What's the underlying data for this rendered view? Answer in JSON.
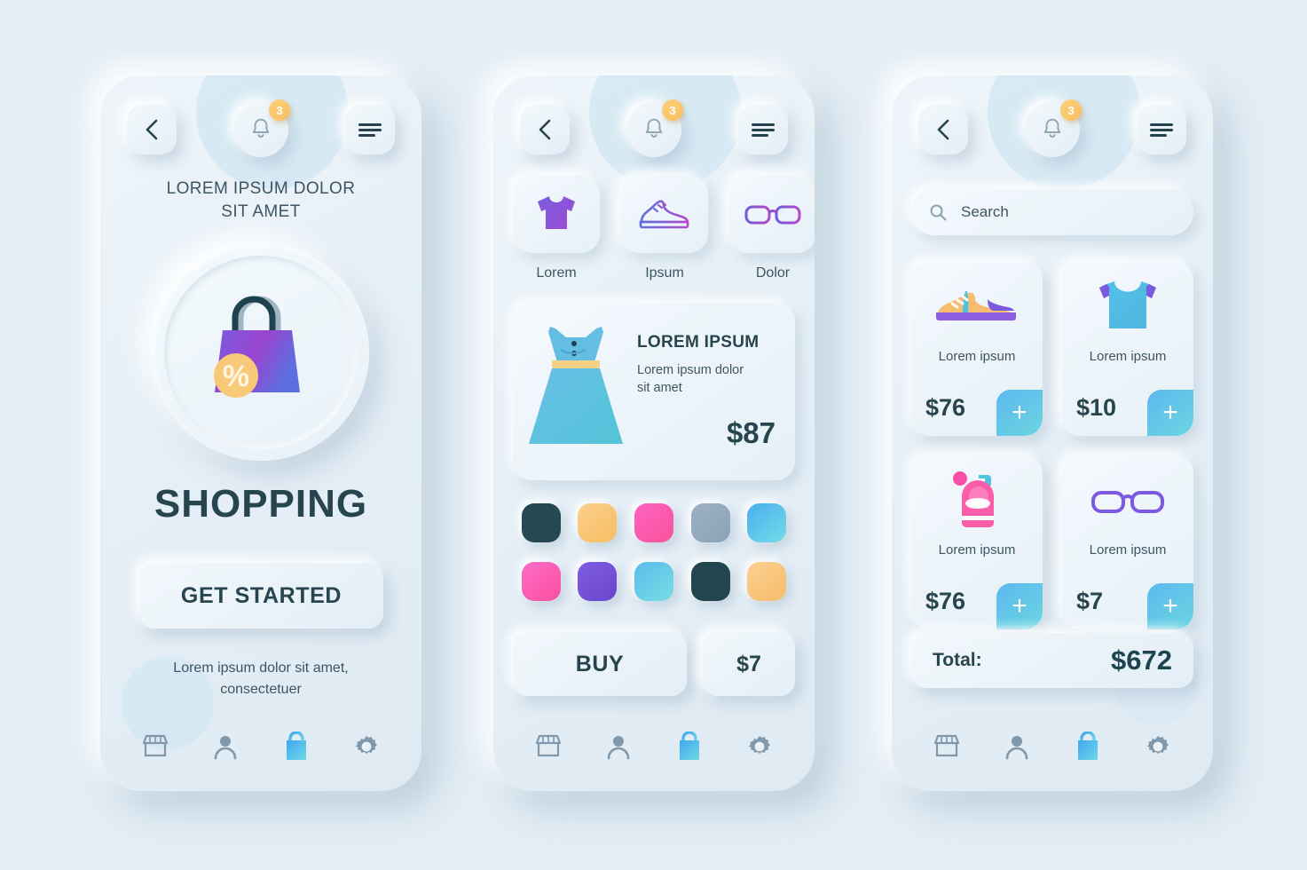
{
  "meta": {
    "background_color": "#e3edf5",
    "accent_color": "#5cb8ef",
    "text_dark": "#27454f",
    "badge_color": "#f7bf5f"
  },
  "header": {
    "back_icon": "chevron-left-icon",
    "bell_icon": "bell-icon",
    "menu_icon": "hamburger-menu-icon",
    "notification_count": "3"
  },
  "bottom_nav": {
    "items": [
      {
        "icon": "store-icon",
        "active": false
      },
      {
        "icon": "user-icon",
        "active": false
      },
      {
        "icon": "shopping-bag-icon",
        "active": true
      },
      {
        "icon": "gear-icon",
        "active": false
      }
    ]
  },
  "screen1": {
    "tagline": "LOREM IPSUM DOLOR\nSIT AMET",
    "hero_icon": "shopping-bag-discount-icon",
    "brand": "SHOPPING",
    "cta_label": "GET STARTED",
    "subtext": "Lorem ipsum dolor sit amet,\nconsectetuer"
  },
  "screen2": {
    "categories": [
      {
        "label": "Lorem",
        "icon": "tshirt-icon"
      },
      {
        "label": "Ipsum",
        "icon": "sneaker-icon"
      },
      {
        "label": "Dolor",
        "icon": "glasses-icon"
      }
    ],
    "product": {
      "image": "dress-icon",
      "title": "LOREM IPSUM",
      "description": "Lorem ipsum dolor\nsit amet",
      "price": "$87"
    },
    "swatches": [
      "#254853",
      "#f7c571",
      "#fa5fb0",
      "#93a9bd",
      "#5fbcee",
      "#fa64b7",
      "#7b55d6",
      "#63bbe8",
      "#254853",
      "#f7c06a"
    ],
    "buy_label": "BUY",
    "price_label": "$7"
  },
  "screen3": {
    "search_placeholder": "Search",
    "search_icon": "search-icon",
    "products": [
      {
        "name": "Lorem ipsum",
        "price": "$76",
        "icon": "sneaker-color-icon",
        "add_label": "+"
      },
      {
        "name": "Lorem ipsum",
        "price": "$10",
        "icon": "tshirt-blue-icon",
        "add_label": "+"
      },
      {
        "name": "Lorem ipsum",
        "price": "$76",
        "icon": "backpack-icon",
        "add_label": "+"
      },
      {
        "name": "Lorem ipsum",
        "price": "$7",
        "icon": "glasses-purple-icon",
        "add_label": "+"
      }
    ],
    "total_label": "Total:",
    "total_value": "$672"
  }
}
